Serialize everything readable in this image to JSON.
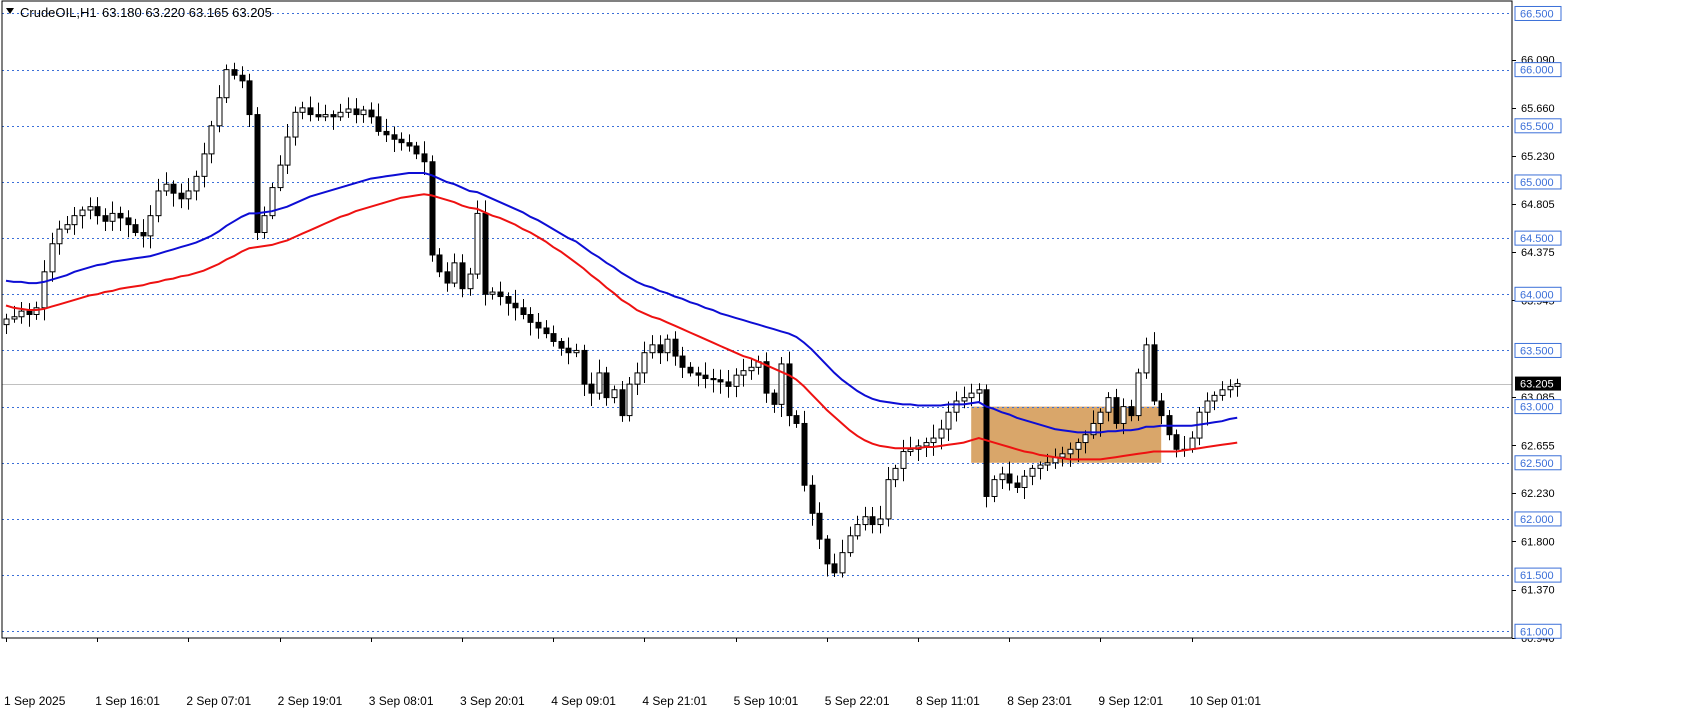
{
  "header": {
    "symbol_timeframe": "CrudeOIL,H1",
    "ohlc": "63.180 63.220 63.165 63.205"
  },
  "colors": {
    "background": "#ffffff",
    "grid_dotted": "#3b6fd8",
    "candle_bull_body": "#ffffff",
    "candle_bear_body": "#000000",
    "candle_outline": "#000000",
    "ma_fast": "#0d0dd4",
    "ma_slow": "#ee1111",
    "zone_fill": "#d9a66a",
    "price_label_bg": "#ffffff",
    "price_label_border": "#3b6fd8",
    "current_price_bg": "#000000",
    "current_price_text": "#ffffff"
  },
  "chart_data": {
    "type": "candlestick",
    "title": "CrudeOIL,H1",
    "ylim": [
      60.94,
      66.62
    ],
    "y_axis_ticks": [
      "66.090",
      "65.660",
      "65.230",
      "64.805",
      "64.375",
      "63.945",
      "63.085",
      "62.655",
      "62.230",
      "61.800",
      "61.370",
      "60.940"
    ],
    "level_lines": [
      "66.500",
      "66.000",
      "65.500",
      "65.000",
      "64.500",
      "64.000",
      "63.500",
      "63.000",
      "62.500",
      "62.000",
      "61.500",
      "61.000"
    ],
    "current_price": "63.205",
    "x_axis_labels": [
      "1 Sep 2025",
      "1 Sep 16:01",
      "2 Sep 07:01",
      "2 Sep 19:01",
      "3 Sep 08:01",
      "3 Sep 20:01",
      "4 Sep 09:01",
      "4 Sep 21:01",
      "5 Sep 10:01",
      "5 Sep 22:01",
      "8 Sep 11:01",
      "8 Sep 23:01",
      "9 Sep 12:01",
      "10 Sep 01:01"
    ],
    "zone": {
      "y_low": 62.5,
      "y_high": 63.0,
      "from_bar": 127,
      "to_bar": 152
    },
    "closes": [
      63.78,
      63.8,
      63.85,
      63.82,
      63.88,
      64.2,
      64.45,
      64.58,
      64.62,
      64.7,
      64.75,
      64.78,
      64.7,
      64.65,
      64.72,
      64.68,
      64.62,
      64.55,
      64.52,
      64.7,
      64.92,
      64.98,
      64.9,
      64.85,
      64.92,
      65.05,
      65.25,
      65.5,
      65.75,
      66.0,
      65.95,
      65.9,
      65.6,
      64.55,
      64.7,
      64.95,
      65.15,
      65.4,
      65.62,
      65.66,
      65.6,
      65.58,
      65.6,
      65.58,
      65.62,
      65.65,
      65.6,
      65.64,
      65.58,
      65.45,
      65.42,
      65.38,
      65.35,
      65.32,
      65.25,
      65.18,
      64.35,
      64.2,
      64.1,
      64.28,
      64.05,
      64.18,
      64.72,
      64.0,
      64.02,
      63.98,
      63.92,
      63.88,
      63.82,
      63.75,
      63.7,
      63.65,
      63.58,
      63.52,
      63.48,
      63.5,
      63.2,
      63.12,
      63.3,
      63.08,
      63.15,
      62.92,
      63.2,
      63.3,
      63.48,
      63.55,
      63.48,
      63.6,
      63.45,
      63.35,
      63.3,
      63.28,
      63.25,
      63.24,
      63.22,
      63.18,
      63.28,
      63.32,
      63.35,
      63.4,
      63.12,
      63.02,
      63.38,
      62.92,
      62.85,
      62.3,
      62.05,
      61.82,
      61.6,
      61.52,
      61.7,
      61.85,
      61.95,
      62.02,
      61.95,
      62.0,
      62.35,
      62.45,
      62.6,
      62.62,
      62.65,
      62.68,
      62.72,
      62.8,
      62.95,
      63.05,
      63.08,
      63.12,
      63.15,
      62.2,
      62.35,
      62.4,
      62.32,
      62.28,
      62.38,
      62.45,
      62.48,
      62.5,
      62.55,
      62.58,
      62.62,
      62.68,
      62.75,
      62.85,
      62.95,
      63.08,
      62.85,
      63.0,
      62.92,
      63.3,
      63.55,
      63.05,
      62.92,
      62.75,
      62.62,
      62.62,
      62.72,
      62.95,
      63.05,
      63.1,
      63.15,
      63.18,
      63.205
    ],
    "series": [
      {
        "name": "",
        "role": "fast moving average",
        "color": "#0d0dd4",
        "start_bar": 0,
        "values": [
          64.12,
          64.11,
          64.11,
          64.1,
          64.1,
          64.11,
          64.13,
          64.15,
          64.17,
          64.2,
          64.22,
          64.24,
          64.26,
          64.27,
          64.29,
          64.3,
          64.31,
          64.32,
          64.33,
          64.34,
          64.36,
          64.38,
          64.4,
          64.42,
          64.44,
          64.46,
          64.49,
          64.52,
          64.56,
          64.61,
          64.65,
          64.69,
          64.72,
          64.72,
          64.73,
          64.74,
          64.76,
          64.78,
          64.81,
          64.84,
          64.87,
          64.89,
          64.91,
          64.93,
          64.95,
          64.97,
          64.99,
          65.01,
          65.03,
          65.04,
          65.05,
          65.06,
          65.07,
          65.08,
          65.08,
          65.08,
          65.06,
          65.03,
          65.0,
          64.98,
          64.95,
          64.92,
          64.91,
          64.88,
          64.85,
          64.82,
          64.79,
          64.76,
          64.73,
          64.69,
          64.66,
          64.62,
          64.58,
          64.54,
          64.5,
          64.47,
          64.42,
          64.37,
          64.33,
          64.28,
          64.24,
          64.19,
          64.15,
          64.11,
          64.08,
          64.06,
          64.03,
          64.01,
          63.98,
          63.96,
          63.93,
          63.91,
          63.88,
          63.86,
          63.83,
          63.81,
          63.79,
          63.77,
          63.75,
          63.73,
          63.71,
          63.69,
          63.67,
          63.65,
          63.62,
          63.57,
          63.51,
          63.44,
          63.37,
          63.3,
          63.24,
          63.19,
          63.14,
          63.1,
          63.07,
          63.05,
          63.04,
          63.03,
          63.02,
          63.02,
          63.01,
          63.01,
          63.01,
          63.01,
          63.02,
          63.02,
          63.02,
          63.03,
          63.04,
          63.0,
          62.98,
          62.95,
          62.93,
          62.9,
          62.88,
          62.86,
          62.84,
          62.82,
          62.8,
          62.79,
          62.78,
          62.77,
          62.77,
          62.77,
          62.77,
          62.78,
          62.78,
          62.79,
          62.79,
          62.8,
          62.82,
          62.82,
          62.83,
          62.83,
          62.83,
          62.83,
          62.83,
          62.84,
          62.85,
          62.86,
          62.87,
          62.89,
          62.9
        ]
      },
      {
        "name": "",
        "role": "slow moving average",
        "color": "#ee1111",
        "start_bar": 0,
        "values": [
          63.9,
          63.88,
          63.87,
          63.86,
          63.86,
          63.87,
          63.89,
          63.91,
          63.93,
          63.95,
          63.97,
          63.99,
          64.0,
          64.02,
          64.03,
          64.05,
          64.06,
          64.07,
          64.08,
          64.1,
          64.11,
          64.13,
          64.14,
          64.16,
          64.17,
          64.19,
          64.21,
          64.24,
          64.27,
          64.31,
          64.34,
          64.38,
          64.41,
          64.42,
          64.43,
          64.44,
          64.46,
          64.48,
          64.51,
          64.54,
          64.57,
          64.6,
          64.63,
          64.66,
          64.69,
          64.71,
          64.74,
          64.76,
          64.78,
          64.8,
          64.82,
          64.84,
          64.86,
          64.87,
          64.88,
          64.89,
          64.88,
          64.86,
          64.84,
          64.82,
          64.79,
          64.77,
          64.76,
          64.73,
          64.7,
          64.68,
          64.65,
          64.62,
          64.58,
          64.55,
          64.51,
          64.47,
          64.42,
          64.38,
          64.33,
          64.28,
          64.23,
          64.17,
          64.12,
          64.06,
          64.01,
          63.95,
          63.91,
          63.86,
          63.83,
          63.8,
          63.78,
          63.75,
          63.72,
          63.69,
          63.66,
          63.63,
          63.6,
          63.57,
          63.54,
          63.51,
          63.48,
          63.45,
          63.43,
          63.4,
          63.37,
          63.34,
          63.31,
          63.28,
          63.24,
          63.18,
          63.11,
          63.04,
          62.97,
          62.91,
          62.85,
          62.79,
          62.74,
          62.7,
          62.67,
          62.65,
          62.64,
          62.63,
          62.63,
          62.63,
          62.63,
          62.64,
          62.64,
          62.65,
          62.66,
          62.67,
          62.68,
          62.7,
          62.72,
          62.7,
          62.68,
          62.66,
          62.64,
          62.62,
          62.6,
          62.59,
          62.57,
          62.56,
          62.55,
          62.54,
          62.53,
          62.53,
          62.53,
          62.53,
          62.53,
          62.54,
          62.55,
          62.56,
          62.57,
          62.58,
          62.59,
          62.6,
          62.6,
          62.6,
          62.6,
          62.61,
          62.62,
          62.63,
          62.64,
          62.65,
          62.66,
          62.67,
          62.68
        ]
      }
    ]
  }
}
